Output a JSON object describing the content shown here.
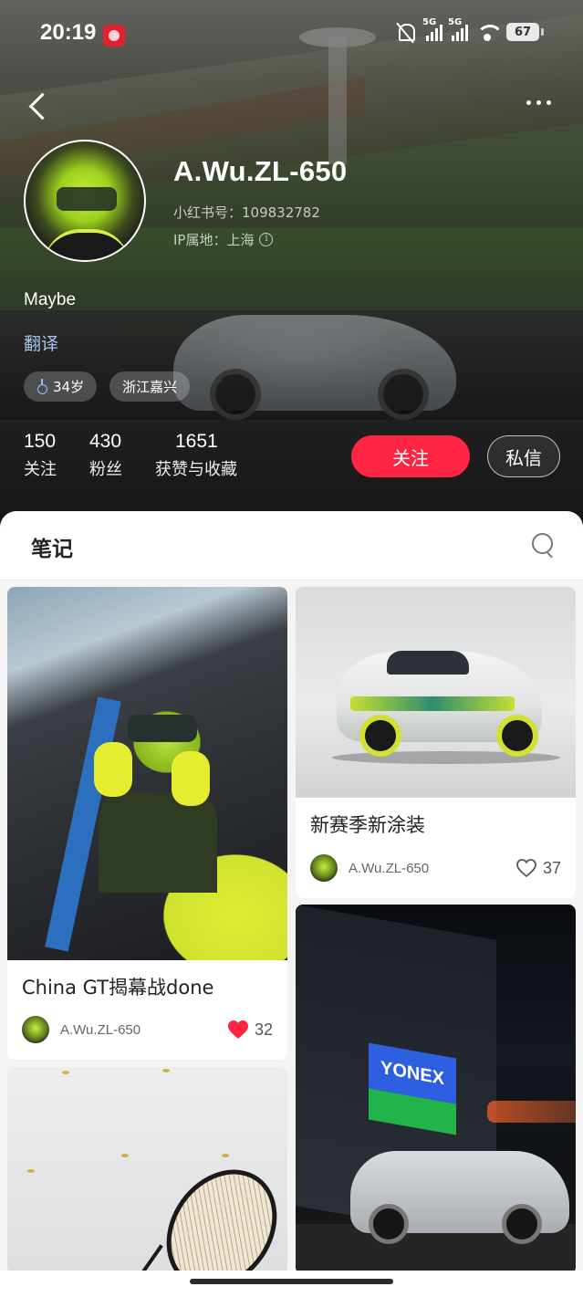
{
  "status_bar": {
    "time": "20:19",
    "network1": "5G",
    "network2": "5G",
    "battery": "67"
  },
  "profile": {
    "name": "A.Wu.ZL-650",
    "redbook_id": "小红书号：109832782",
    "ip_location": "IP属地：上海",
    "bio": "Maybe",
    "translate": "翻译",
    "tags": [
      {
        "icon": "male-icon",
        "label": "34岁"
      },
      {
        "label": "浙江嘉兴"
      }
    ],
    "stats": [
      {
        "value": "150",
        "label": "关注"
      },
      {
        "value": "430",
        "label": "粉丝"
      },
      {
        "value": "1651",
        "label": "获赞与收藏"
      }
    ],
    "follow_label": "关注",
    "message_label": "私信"
  },
  "notes": {
    "title": "笔记",
    "cards": [
      {
        "title": "China GT揭幕战done",
        "author": "A.Wu.ZL-650",
        "likes": "32",
        "liked": true,
        "image": "driver in cockpit"
      },
      {
        "title": "新赛季新涂装",
        "author": "A.Wu.ZL-650",
        "likes": "37",
        "liked": false,
        "image": "race car livery"
      },
      {
        "image": "yonex store night"
      },
      {
        "image": "badminton racket"
      }
    ]
  },
  "colors": {
    "accent": "#ff2442",
    "translate_link": "#a9c3ea",
    "liked_heart": "#ff2442"
  }
}
